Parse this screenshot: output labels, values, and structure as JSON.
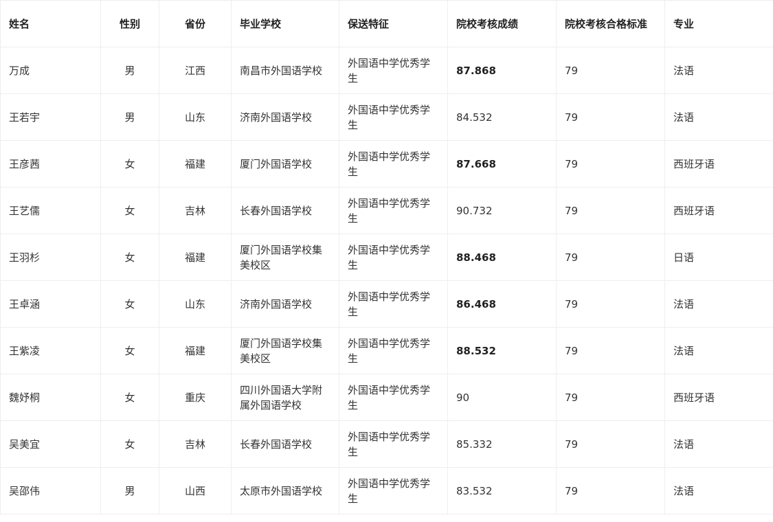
{
  "table": {
    "headers": [
      "姓名",
      "性别",
      "省份",
      "毕业学校",
      "保送特征",
      "院校考核成绩",
      "院校考核合格标准",
      "专业"
    ],
    "rows": [
      {
        "name": "万成",
        "gender": "男",
        "province": "江西",
        "school": "南昌市外国语学校",
        "feature": "外国语中学优秀学生",
        "score": "87.868",
        "standard": "79",
        "major": "法语"
      },
      {
        "name": "王若宇",
        "gender": "男",
        "province": "山东",
        "school": "济南外国语学校",
        "feature": "外国语中学优秀学生",
        "score": "84.532",
        "standard": "79",
        "major": "法语"
      },
      {
        "name": "王彦茜",
        "gender": "女",
        "province": "福建",
        "school": "厦门外国语学校",
        "feature": "外国语中学优秀学生",
        "score": "87.668",
        "standard": "79",
        "major": "西班牙语"
      },
      {
        "name": "王艺儒",
        "gender": "女",
        "province": "吉林",
        "school": "长春外国语学校",
        "feature": "外国语中学优秀学生",
        "score": "90.732",
        "standard": "79",
        "major": "西班牙语"
      },
      {
        "name": "王羽杉",
        "gender": "女",
        "province": "福建",
        "school": "厦门外国语学校集美校区",
        "feature": "外国语中学优秀学生",
        "score": "88.468",
        "standard": "79",
        "major": "日语"
      },
      {
        "name": "王卓涵",
        "gender": "女",
        "province": "山东",
        "school": "济南外国语学校",
        "feature": "外国语中学优秀学生",
        "score": "86.468",
        "standard": "79",
        "major": "法语"
      },
      {
        "name": "王紫凌",
        "gender": "女",
        "province": "福建",
        "school": "厦门外国语学校集美校区",
        "feature": "外国语中学优秀学生",
        "score": "88.532",
        "standard": "79",
        "major": "法语"
      },
      {
        "name": "魏妤桐",
        "gender": "女",
        "province": "重庆",
        "school": "四川外国语大学附属外国语学校",
        "feature": "外国语中学优秀学生",
        "score": "90",
        "standard": "79",
        "major": "西班牙语"
      },
      {
        "name": "吴美宜",
        "gender": "女",
        "province": "吉林",
        "school": "长春外国语学校",
        "feature": "外国语中学优秀学生",
        "score": "85.332",
        "standard": "79",
        "major": "法语"
      },
      {
        "name": "吴邵伟",
        "gender": "男",
        "province": "山西",
        "school": "太原市外国语学校",
        "feature": "外国语中学优秀学生",
        "score": "83.532",
        "standard": "79",
        "major": "法语"
      }
    ]
  }
}
